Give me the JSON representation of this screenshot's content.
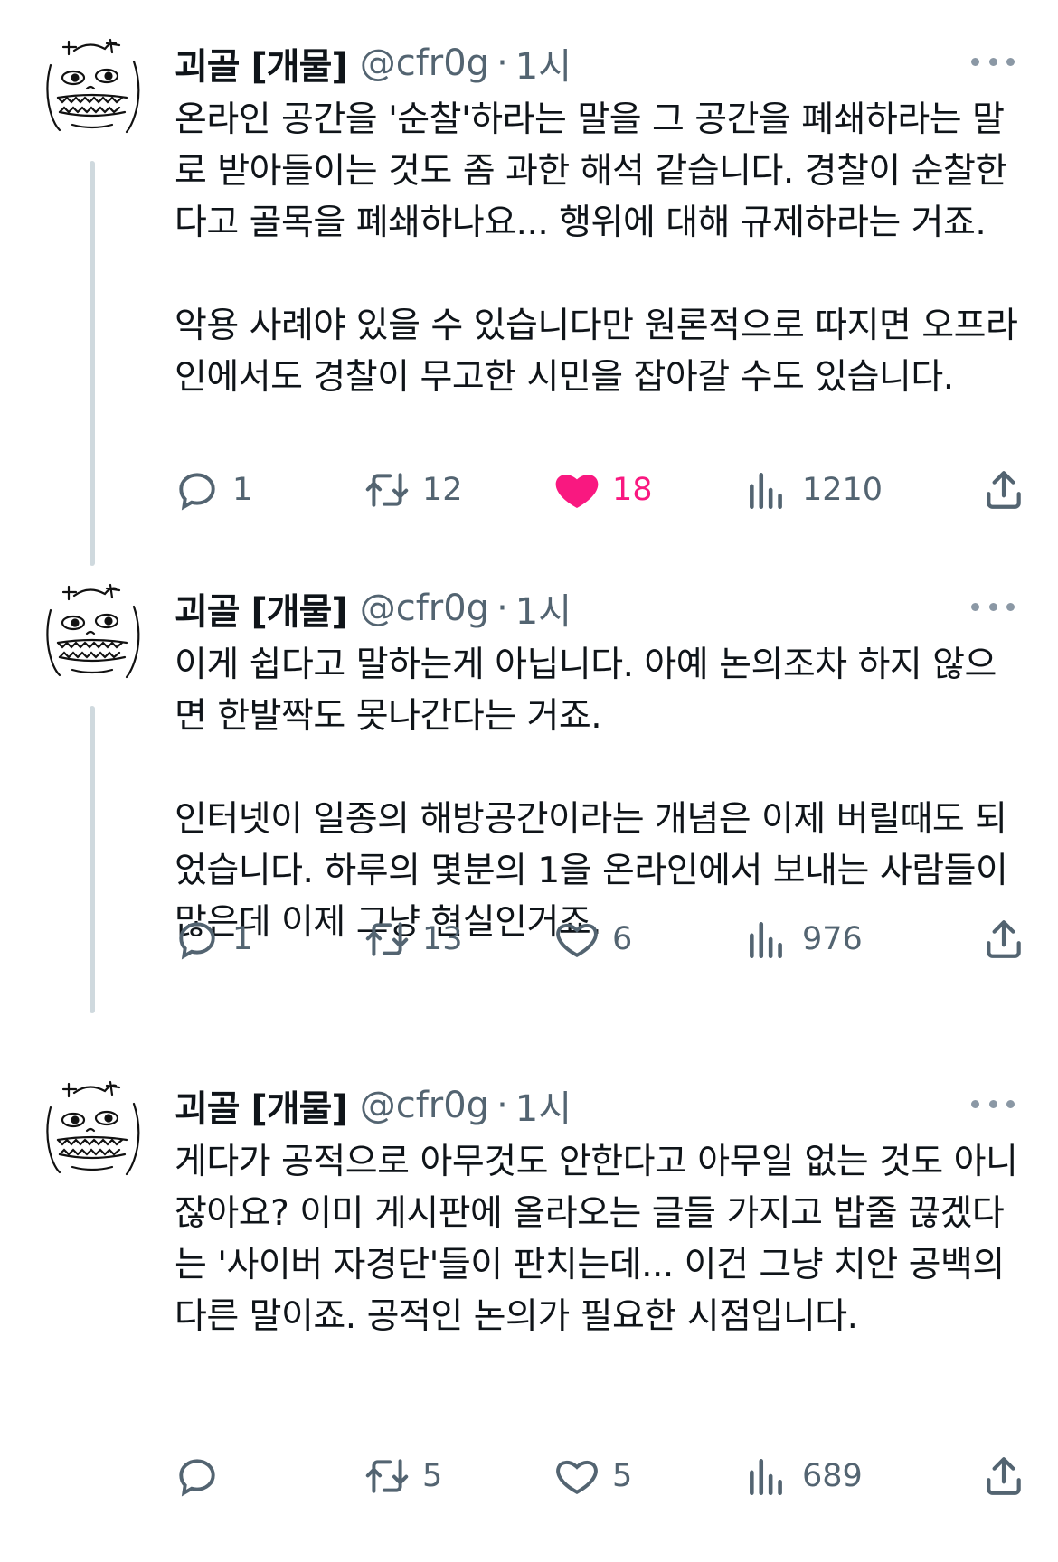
{
  "tweets": [
    {
      "name": "괴골 [개물]",
      "handle": "@cfr0g",
      "dot": "·",
      "time": "1시",
      "text": "온라인 공간을 '순찰'하라는 말을 그 공간을 폐쇄하라는 말로 받아들이는 것도 좀 과한 해석 같습니다. 경찰이 순찰한다고 골목을 폐쇄하나요... 행위에 대해 규제하라는 거죠.\n\n악용 사례야 있을 수 있습니다만 원론적으로 따지면 오프라인에서도 경찰이 무고한 시민을 잡아갈 수도 있습니다.",
      "replies": "1",
      "retweets": "12",
      "likes": "18",
      "liked": true,
      "views": "1210"
    },
    {
      "name": "괴골 [개물]",
      "handle": "@cfr0g",
      "dot": "·",
      "time": "1시",
      "text": "이게 쉽다고 말하는게 아닙니다. 아예 논의조차 하지 않으면 한발짝도 못나간다는 거죠.\n\n인터넷이 일종의 해방공간이라는 개념은 이제 버릴때도 되었습니다. 하루의 몇분의 1을 온라인에서 보내는 사람들이 많은데 이제 그냥 현실인거죠.",
      "replies": "1",
      "retweets": "13",
      "likes": "6",
      "liked": false,
      "views": "976"
    },
    {
      "name": "괴골 [개물]",
      "handle": "@cfr0g",
      "dot": "·",
      "time": "1시",
      "text": "게다가 공적으로 아무것도 안한다고 아무일 없는 것도 아니잖아요? 이미 게시판에 올라오는 글들 가지고 밥줄 끊겠다는 '사이버 자경단'들이 판치는데... 이건 그냥 치안 공백의 다른 말이죠. 공적인 논의가 필요한 시점입니다.",
      "replies": "",
      "retweets": "5",
      "likes": "5",
      "liked": false,
      "views": "689"
    }
  ],
  "colors": {
    "text": "#0f1419",
    "secondary": "#536471",
    "like_active": "#f91880",
    "thread_line": "#cfd9de"
  },
  "icons": {
    "reply": "reply-icon",
    "retweet": "retweet-icon",
    "like": "heart-icon",
    "views": "views-icon",
    "share": "share-icon",
    "more": "more-icon"
  }
}
